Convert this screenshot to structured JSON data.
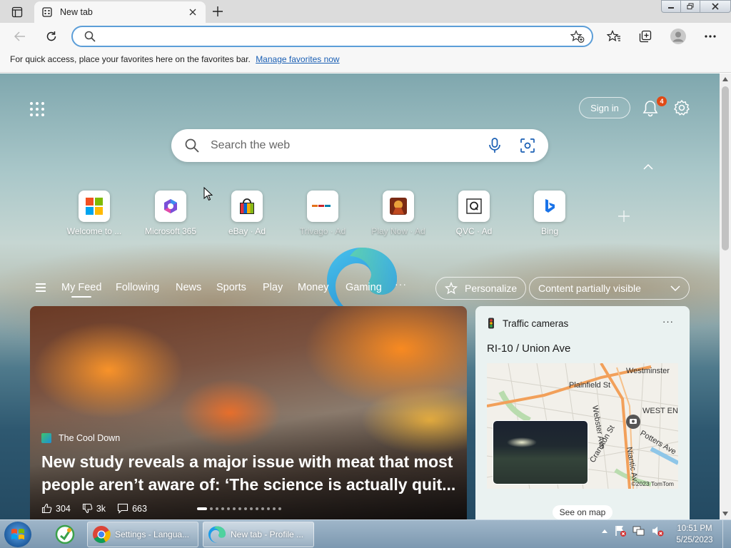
{
  "browser": {
    "tab": {
      "title": "New tab"
    },
    "address": {
      "value": "",
      "placeholder": ""
    },
    "favorites_hint": {
      "text": "For quick access, place your favorites here on the favorites bar.",
      "link": "Manage favorites now"
    }
  },
  "header": {
    "signin_label": "Sign in",
    "notifications_count": "4"
  },
  "search": {
    "placeholder": "Search the web"
  },
  "quick_links": [
    {
      "label": "Welcome to ...",
      "icon": "microsoft-logo-icon",
      "dim": false
    },
    {
      "label": "Microsoft 365",
      "icon": "microsoft365-icon",
      "dim": false
    },
    {
      "label": "eBay · Ad",
      "icon": "ebay-bag-icon",
      "dim": false
    },
    {
      "label": "Trivago · Ad",
      "icon": "trivago-icon",
      "dim": true
    },
    {
      "label": "Play Now · Ad",
      "icon": "game-icon",
      "dim": true
    },
    {
      "label": "QVC · Ad",
      "icon": "qvc-icon",
      "dim": false
    },
    {
      "label": "Bing",
      "icon": "bing-icon",
      "dim": false
    }
  ],
  "feed_nav": {
    "items": [
      "My Feed",
      "Following",
      "News",
      "Sports",
      "Play",
      "Money",
      "Gaming"
    ],
    "more": "···",
    "personalize_label": "Personalize",
    "visibility_label": "Content partially visible"
  },
  "hero": {
    "source": "The Cool Down",
    "title": "New study reveals a major issue with meat that most people aren’t aware of: ‘The science is actually quit...",
    "likes": "304",
    "dislikes": "3k",
    "comments": "663",
    "slide_count": 14,
    "active_slide": 0
  },
  "traffic": {
    "title": "Traffic cameras",
    "more": "···",
    "road": "RI-10 / Union Ave",
    "map_copyright": "©2023 TomTom",
    "see_map_label": "See on map",
    "map_labels": [
      "Westminster",
      "Plainfield St",
      "WEST EN",
      "Webster Ave",
      "Potters Ave",
      "Cranston St",
      "Niantic Av"
    ]
  },
  "taskbar": {
    "windows": [
      {
        "label": "Settings - Langua...",
        "icon": "chrome-icon"
      },
      {
        "label": "New tab - Profile ...",
        "icon": "edge-icon"
      }
    ],
    "clock_time": "10:51 PM",
    "clock_date": "5/25/2023"
  },
  "colors": {
    "accent": "#1a5fb4",
    "address_border": "#5c9ed8",
    "badge": "#e04a16"
  }
}
